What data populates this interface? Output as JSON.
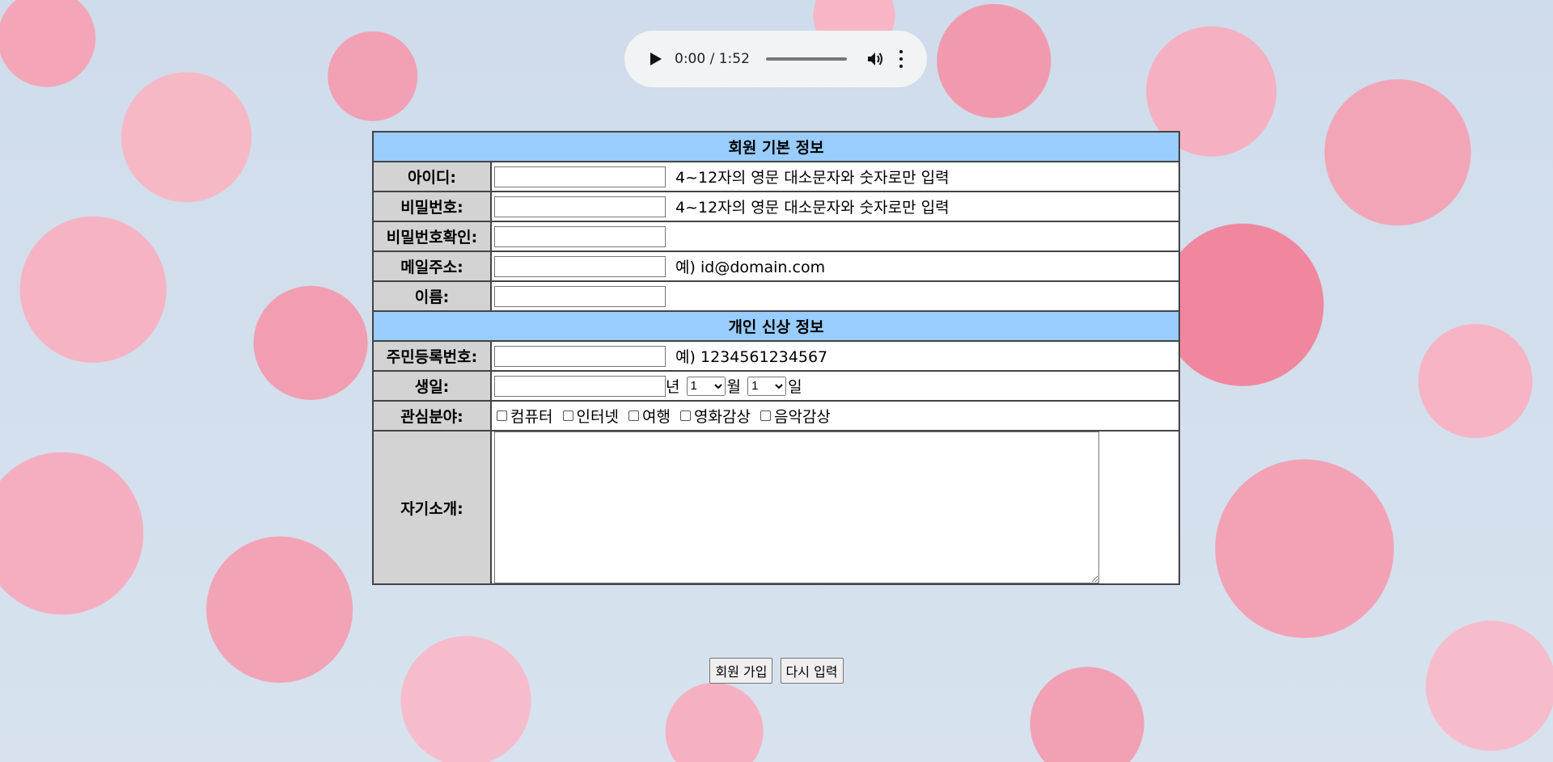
{
  "audio": {
    "time_display": "0:00 / 1:52"
  },
  "basic_info": {
    "header": "회원 기본 정보",
    "id_label": "아이디:",
    "id_hint": "4~12자의 영문 대소문자와 숫자로만 입력",
    "pw_label": "비밀번호:",
    "pw_hint": "4~12자의 영문 대소문자와 숫자로만 입력",
    "pw_confirm_label": "비밀번호확인:",
    "email_label": "메일주소:",
    "email_hint": "예) id@domain.com",
    "name_label": "이름:"
  },
  "personal_info": {
    "header": "개인 신상 정보",
    "ssn_label": "주민등록번호:",
    "ssn_hint": "예) 1234561234567",
    "birth_label": "생일:",
    "year_suffix": "년",
    "month_value": "1",
    "month_suffix": "월",
    "day_value": "1",
    "day_suffix": "일",
    "interests_label": "관심분야:",
    "interests": [
      "컴퓨터",
      "인터넷",
      "여행",
      "영화감상",
      "음악감상"
    ],
    "intro_label": "자기소개:"
  },
  "buttons": {
    "submit": "회원 가입",
    "reset": "다시 입력"
  }
}
